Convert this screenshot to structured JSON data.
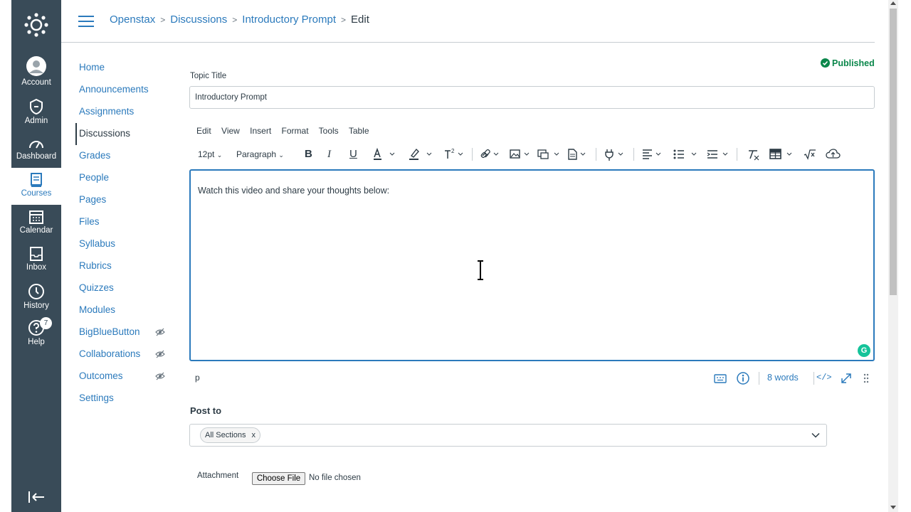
{
  "global_nav": {
    "items": [
      {
        "label": "Account",
        "icon": "avatar-icon"
      },
      {
        "label": "Admin",
        "icon": "shield-icon"
      },
      {
        "label": "Dashboard",
        "icon": "dashboard-icon"
      },
      {
        "label": "Courses",
        "icon": "book-icon"
      },
      {
        "label": "Calendar",
        "icon": "calendar-icon"
      },
      {
        "label": "Inbox",
        "icon": "inbox-icon"
      },
      {
        "label": "History",
        "icon": "clock-icon"
      },
      {
        "label": "Help",
        "icon": "help-icon"
      }
    ],
    "help_badge": "7",
    "active_item": "Courses"
  },
  "breadcrumb": {
    "items": [
      "Openstax",
      "Discussions",
      "Introductory Prompt"
    ],
    "current": "Edit"
  },
  "course_nav": {
    "items": [
      {
        "label": "Home"
      },
      {
        "label": "Announcements"
      },
      {
        "label": "Assignments"
      },
      {
        "label": "Discussions"
      },
      {
        "label": "Grades"
      },
      {
        "label": "People"
      },
      {
        "label": "Pages"
      },
      {
        "label": "Files"
      },
      {
        "label": "Syllabus"
      },
      {
        "label": "Rubrics"
      },
      {
        "label": "Quizzes"
      },
      {
        "label": "Modules"
      },
      {
        "label": "BigBlueButton",
        "hidden_icon": "eye-slash-icon"
      },
      {
        "label": "Collaborations",
        "hidden_icon": "eye-slash-icon"
      },
      {
        "label": "Outcomes",
        "hidden_icon": "eye-slash-icon"
      },
      {
        "label": "Settings"
      }
    ],
    "active_item": "Discussions"
  },
  "form": {
    "status": "Published",
    "topic_title_label": "Topic Title",
    "topic_title_value": "Introductory Prompt",
    "post_to_label": "Post to",
    "post_to_tag": "All Sections",
    "post_to_tag_remove": "x",
    "attachment_label": "Attachment",
    "choose_file_label": "Choose File",
    "no_file_text": "No file chosen"
  },
  "editor": {
    "menus": [
      "Edit",
      "View",
      "Insert",
      "Format",
      "Tools",
      "Table"
    ],
    "font_size": "12pt",
    "block_format": "Paragraph",
    "content": "Watch this video and share your thoughts below:",
    "path": "p",
    "word_count": "8 words",
    "html_toggle": "</>",
    "grammarly": "G"
  },
  "colors": {
    "nav_bg": "#394b58",
    "link": "#2b7abc",
    "published": "#0b874b",
    "text": "#2d3b45"
  }
}
